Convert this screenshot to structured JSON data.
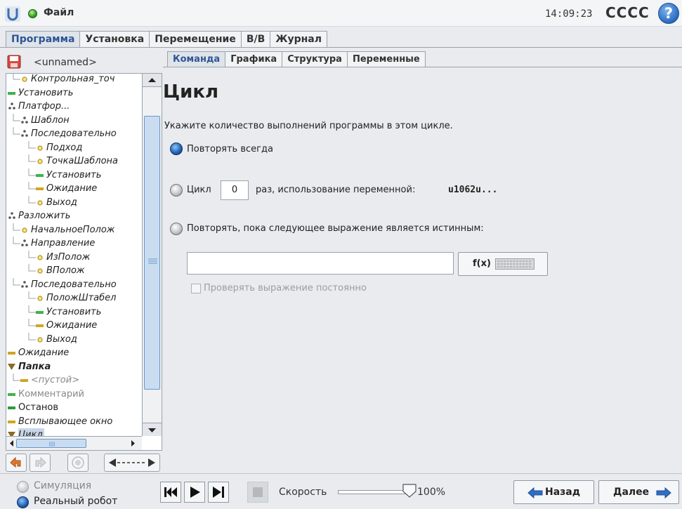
{
  "header": {
    "file_menu": "Файл",
    "time": "14:09:23",
    "robot_name": "CCCC"
  },
  "main_tabs": [
    "Программа",
    "Установка",
    "Перемещение",
    "В/В",
    "Журнал"
  ],
  "program": {
    "name": "<unnamed>"
  },
  "tree": [
    {
      "label": "Контрольная_точ",
      "icon": "waypoint",
      "indent": 1,
      "style": "italic"
    },
    {
      "label": "Установить",
      "icon": "set",
      "indent": 0,
      "style": "italic"
    },
    {
      "label": "Платфор...",
      "icon": "pallet",
      "indent": 0,
      "style": "italic"
    },
    {
      "label": "Шаблон",
      "icon": "pallet",
      "indent": 1,
      "style": "italic"
    },
    {
      "label": "Последовательно",
      "icon": "pallet",
      "indent": 1,
      "style": "italic"
    },
    {
      "label": "Подход",
      "icon": "waypoint",
      "indent": 2,
      "style": "italic"
    },
    {
      "label": "ТочкаШаблона",
      "icon": "waypoint",
      "indent": 2,
      "style": "italic"
    },
    {
      "label": "Установить",
      "icon": "set",
      "indent": 2,
      "style": "italic"
    },
    {
      "label": "Ожидание",
      "icon": "wait",
      "indent": 2,
      "style": "italic"
    },
    {
      "label": "Выход",
      "icon": "waypoint",
      "indent": 2,
      "style": "italic"
    },
    {
      "label": "Разложить",
      "icon": "pallet",
      "indent": 0,
      "style": "italic"
    },
    {
      "label": "НачальноеПолож",
      "icon": "waypoint",
      "indent": 1,
      "style": "italic"
    },
    {
      "label": "Направление",
      "icon": "pallet",
      "indent": 1,
      "style": "italic"
    },
    {
      "label": "ИзПолож",
      "icon": "waypoint",
      "indent": 2,
      "style": "italic"
    },
    {
      "label": "ВПолож",
      "icon": "waypoint",
      "indent": 2,
      "style": "italic"
    },
    {
      "label": "Последовательно",
      "icon": "pallet",
      "indent": 1,
      "style": "italic"
    },
    {
      "label": "ПоложШтабел",
      "icon": "waypoint",
      "indent": 2,
      "style": "italic"
    },
    {
      "label": "Установить",
      "icon": "set",
      "indent": 2,
      "style": "italic"
    },
    {
      "label": "Ожидание",
      "icon": "wait",
      "indent": 2,
      "style": "italic"
    },
    {
      "label": "Выход",
      "icon": "waypoint",
      "indent": 2,
      "style": "italic"
    },
    {
      "label": "Ожидание",
      "icon": "wait",
      "indent": 0,
      "style": "italic"
    },
    {
      "label": "Папка",
      "icon": "folder",
      "indent": 0,
      "style": "bold-italic"
    },
    {
      "label": "<пустой>",
      "icon": "empty",
      "indent": 1,
      "style": "grey-italic"
    },
    {
      "label": "Комментарий",
      "icon": "comment",
      "indent": 0,
      "style": "grey"
    },
    {
      "label": "Останов",
      "icon": "halt",
      "indent": 0,
      "style": "normal"
    },
    {
      "label": "Всплывающее окно",
      "icon": "popup",
      "indent": 0,
      "style": "italic"
    },
    {
      "label": "Цикл",
      "icon": "loop",
      "indent": 0,
      "style": "italic",
      "selected": true
    }
  ],
  "sub_tabs": [
    "Команда",
    "Графика",
    "Структура",
    "Переменные"
  ],
  "loop": {
    "title": "Цикл",
    "description": "Укажите количество выполнений программы в этом цикле.",
    "option_always": "Повторять всегда",
    "option_count": "Цикл",
    "count_value": "0",
    "count_suffix": "раз, использование переменной:",
    "count_variable": "u1062u...",
    "option_expression": "Повторять, пока следующее выражение является истинным:",
    "expression_value": "",
    "fx_label": "f(x)",
    "check_continuous": "Проверять выражение постоянно",
    "selected_option": "always"
  },
  "footer": {
    "simulation": "Симуляция",
    "real_robot": "Реальный робот",
    "speed_label": "Скорость",
    "speed_value": "100%",
    "speed_fraction": 1.0,
    "back": "Назад",
    "next": "Далее"
  },
  "colors": {
    "accent": "#2d5595",
    "selection": "#c7d6e8",
    "status_ok": "#39a52a",
    "set_icon": "#3fb34a",
    "wait_icon": "#d1a521",
    "folder_icon": "#8a6b26",
    "halt_icon": "#2e9a38"
  }
}
